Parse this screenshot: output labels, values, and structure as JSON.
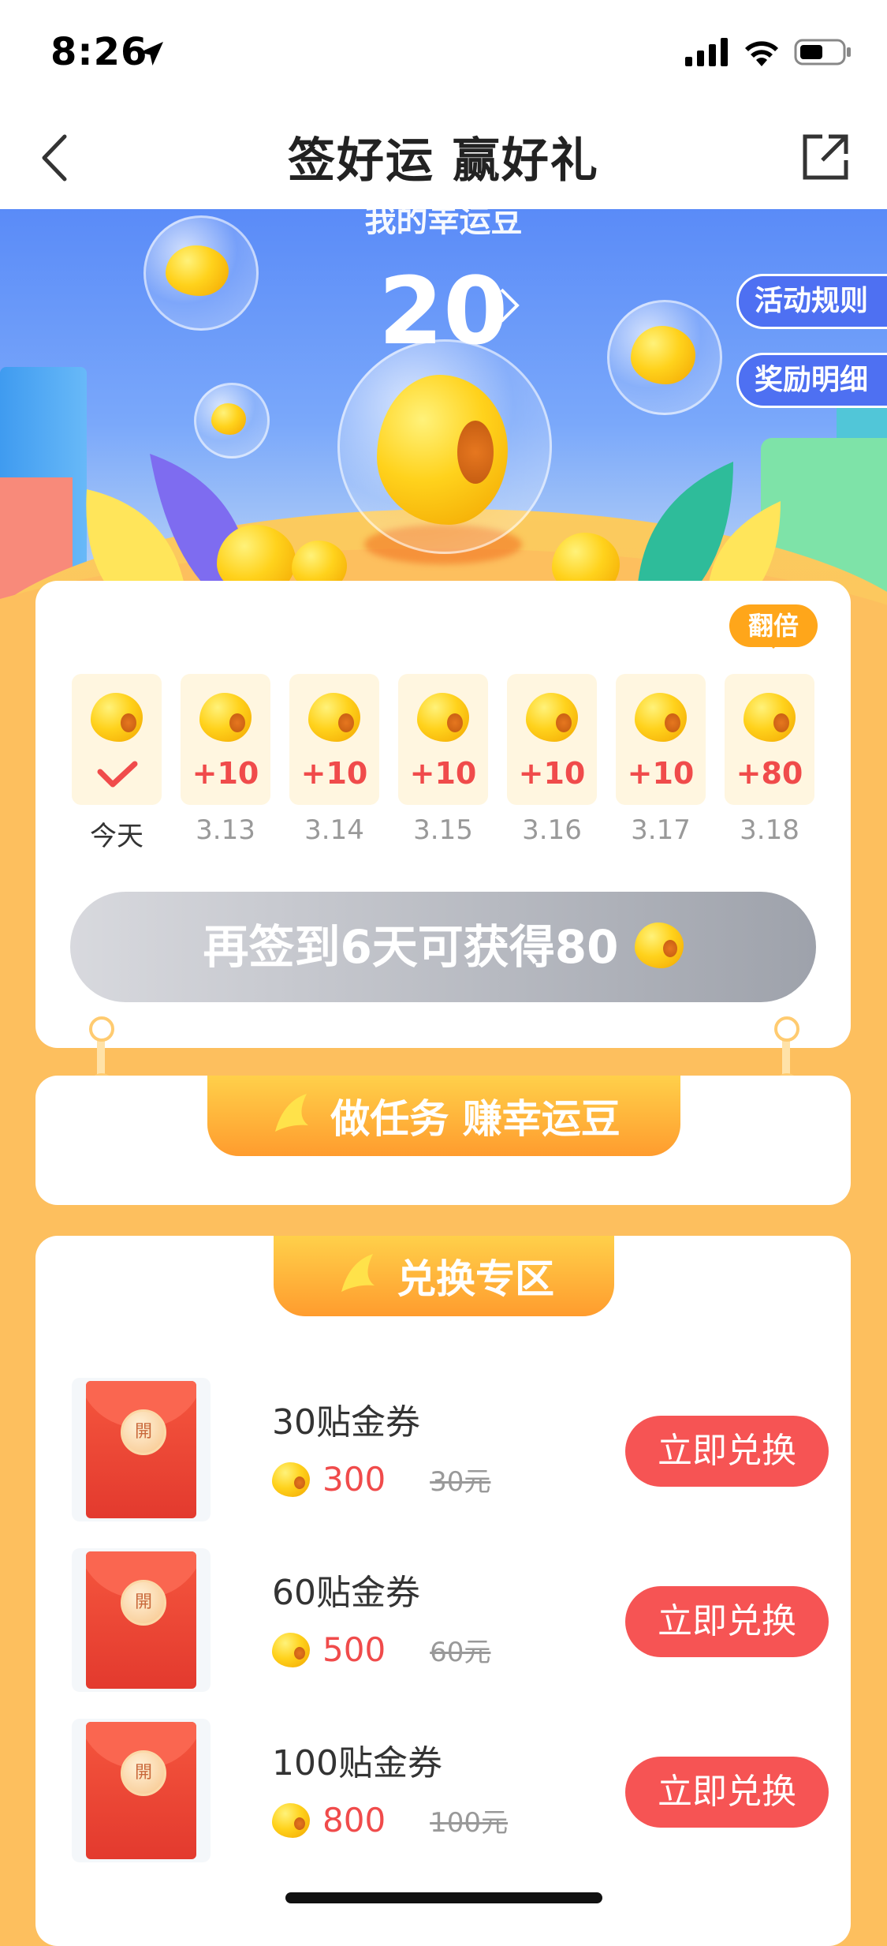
{
  "status_bar": {
    "time": "8:26"
  },
  "nav": {
    "title": "签好运 赢好礼"
  },
  "hero": {
    "subtitle": "我的幸运豆",
    "bean_count": "20",
    "rules_button": "活动规则",
    "detail_button": "奖励明细"
  },
  "signin": {
    "double_badge": "翻倍",
    "days": [
      {
        "date": "今天",
        "value": "",
        "checked": true
      },
      {
        "date": "3.13",
        "value": "+10"
      },
      {
        "date": "3.14",
        "value": "+10"
      },
      {
        "date": "3.15",
        "value": "+10"
      },
      {
        "date": "3.16",
        "value": "+10"
      },
      {
        "date": "3.17",
        "value": "+10"
      },
      {
        "date": "3.18",
        "value": "+80"
      }
    ],
    "button_label": "再签到6天可获得80"
  },
  "tasks": {
    "header": "做任务 赚幸运豆"
  },
  "exchange": {
    "header": "兑换专区",
    "seal_text": "開",
    "items": [
      {
        "title": "30贴金券",
        "price": "300",
        "original": "30元",
        "button": "立即兑换"
      },
      {
        "title": "60贴金券",
        "price": "500",
        "original": "60元",
        "button": "立即兑换"
      },
      {
        "title": "100贴金券",
        "price": "800",
        "original": "100元",
        "button": "立即兑换"
      }
    ]
  }
}
